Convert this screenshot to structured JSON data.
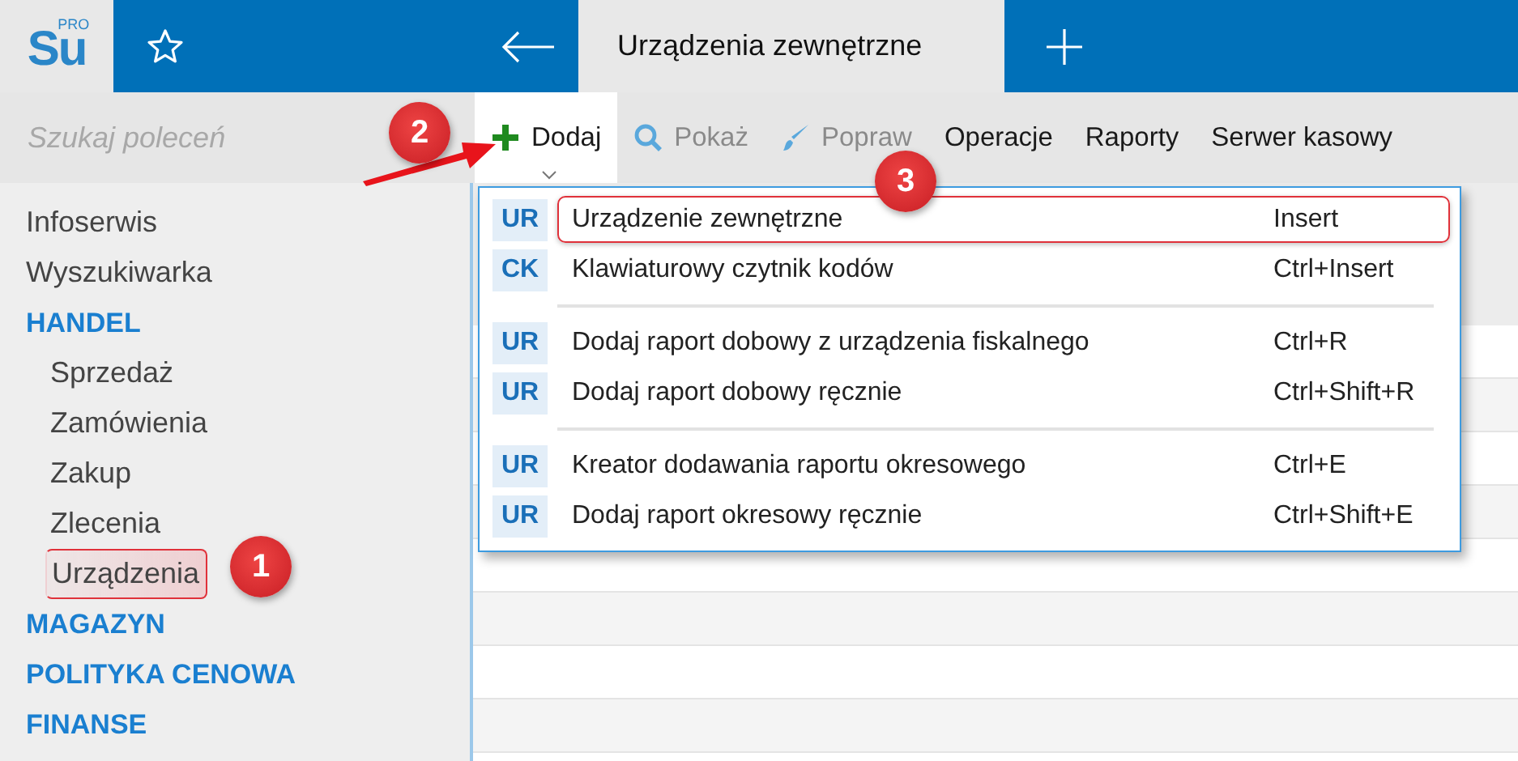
{
  "logo": {
    "text": "Su",
    "badge": "PRO"
  },
  "tabs": [
    {
      "label": "Urządzenia zewnętrzne",
      "selected": true
    }
  ],
  "search": {
    "placeholder": "Szukaj poleceń"
  },
  "toolbar": [
    {
      "label": "Dodaj",
      "kind": "plus",
      "open": true,
      "disabled": false
    },
    {
      "label": "Pokaż",
      "kind": "search",
      "open": false,
      "disabled": true
    },
    {
      "label": "Popraw",
      "kind": "brush",
      "open": false,
      "disabled": true
    },
    {
      "label": "Operacje",
      "kind": "text",
      "open": false,
      "disabled": false
    },
    {
      "label": "Raporty",
      "kind": "text",
      "open": false,
      "disabled": false
    },
    {
      "label": "Serwer kasowy",
      "kind": "text",
      "open": false,
      "disabled": false
    }
  ],
  "sidebar": {
    "items": [
      {
        "label": "Infoserwis",
        "kind": "item",
        "highlighted": false
      },
      {
        "label": "Wyszukiwarka",
        "kind": "item",
        "highlighted": false
      },
      {
        "label": "HANDEL",
        "kind": "section",
        "children": [
          {
            "label": "Sprzedaż",
            "kind": "item",
            "highlighted": false
          },
          {
            "label": "Zamówienia",
            "kind": "item",
            "highlighted": false
          },
          {
            "label": "Zakup",
            "kind": "item",
            "highlighted": false
          },
          {
            "label": "Zlecenia",
            "kind": "item",
            "highlighted": false
          },
          {
            "label": "Urządzenia",
            "kind": "item",
            "highlighted": true
          }
        ]
      },
      {
        "label": "MAGAZYN",
        "kind": "section"
      },
      {
        "label": "POLITYKA CENOWA",
        "kind": "section"
      },
      {
        "label": "FINANSE",
        "kind": "section"
      }
    ]
  },
  "menu": {
    "groups": [
      [
        {
          "code": "UR",
          "label": "Urządzenie zewnętrzne",
          "shortcut": "Insert",
          "highlighted": true
        },
        {
          "code": "CK",
          "label": "Klawiaturowy czytnik kodów",
          "shortcut": "Ctrl+Insert",
          "highlighted": false
        }
      ],
      [
        {
          "code": "UR",
          "label": "Dodaj raport dobowy z urządzenia fiskalnego",
          "shortcut": "Ctrl+R",
          "highlighted": false
        },
        {
          "code": "UR",
          "label": "Dodaj raport dobowy ręcznie",
          "shortcut": "Ctrl+Shift+R",
          "highlighted": false
        }
      ],
      [
        {
          "code": "UR",
          "label": "Kreator dodawania raportu okresowego",
          "shortcut": "Ctrl+E",
          "highlighted": false
        },
        {
          "code": "UR",
          "label": "Dodaj raport okresowy ręcznie",
          "shortcut": "Ctrl+Shift+E",
          "highlighted": false
        }
      ]
    ]
  },
  "callouts": [
    {
      "label": "1",
      "arrow": false
    },
    {
      "label": "2",
      "arrow": true
    },
    {
      "label": "3",
      "arrow": false
    }
  ]
}
